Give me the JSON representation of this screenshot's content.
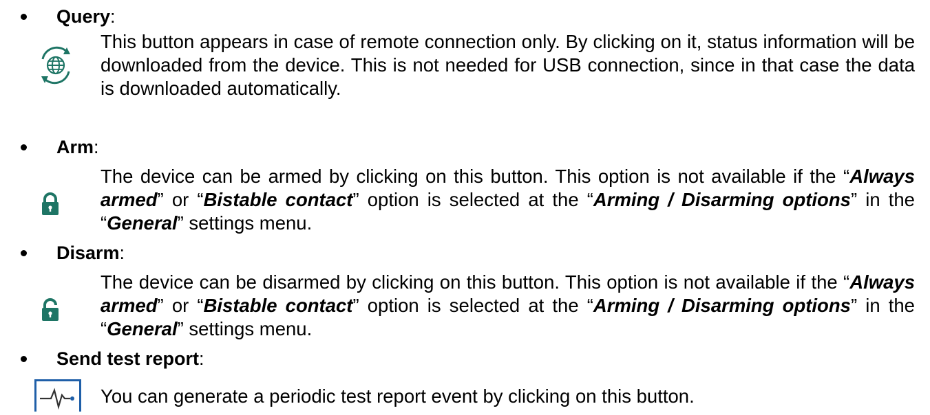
{
  "sections": [
    {
      "title": "Query",
      "icon": "globe-refresh-icon",
      "text": "This button appears in case of remote connection only. By clicking on it, status information will be downloaded from the device. This is not needed for USB connection, since in that case the data is downloaded automatically."
    },
    {
      "title": "Arm",
      "icon": "lock-closed-icon",
      "p1": "The device can be armed by clicking on this button. This option is not available if the “",
      "b1": "Always armed",
      "p2": "” or “",
      "b2": "Bistable contact",
      "p3": "” option is selected at the “",
      "b3": "Arming / Disarming options",
      "p4": "” in the “",
      "b4": "General",
      "p5": "” settings menu."
    },
    {
      "title": "Disarm",
      "icon": "lock-open-icon",
      "p1": "The device can be disarmed by clicking on this button. This option is not available if the “",
      "b1": "Always armed",
      "p2": "” or “",
      "b2": "Bistable contact",
      "p3": "” option is selected at the “",
      "b3": "Arming / Disarming options",
      "p4": "” in the “",
      "b4": "General",
      "p5": "” settings menu."
    },
    {
      "title": "Send test report",
      "icon": "pulse-monitor-icon",
      "text": "You can generate a periodic test report event by clicking on this button."
    }
  ],
  "colors": {
    "icon_teal": "#1E7565",
    "icon_blue": "#1f5fa8",
    "text": "#000000"
  }
}
